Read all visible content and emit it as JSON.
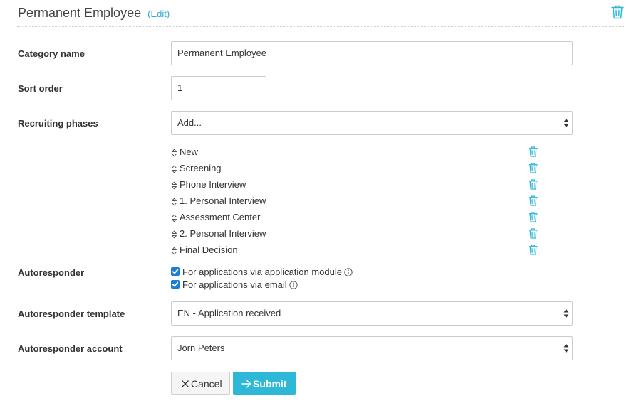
{
  "header": {
    "title": "Permanent Employee",
    "edit_label": "(Edit)"
  },
  "form": {
    "category_label": "Category name",
    "category_value": "Permanent Employee",
    "sort_label": "Sort order",
    "sort_value": "1",
    "phases_label": "Recruiting phases",
    "phases_select": "Add...",
    "phases": [
      "New",
      "Screening",
      "Phone Interview",
      "1. Personal Interview",
      "Assessment Center",
      "2. Personal Interview",
      "Final Decision"
    ],
    "autoresponder_label": "Autoresponder",
    "autoresponder_options": [
      {
        "label": "For applications via application module",
        "checked": true
      },
      {
        "label": "For applications via email",
        "checked": true
      }
    ],
    "template_label": "Autoresponder template",
    "template_value": "EN - Application received",
    "account_label": "Autoresponder account",
    "account_value": "Jörn Peters"
  },
  "buttons": {
    "cancel": "Cancel",
    "submit": "Submit"
  },
  "icons": {
    "delete": "trash-icon",
    "drag": "sort-grip-icon",
    "info": "info-icon",
    "cancel": "close-icon",
    "submit": "arrow-right-icon"
  },
  "colors": {
    "accent": "#2eb8d8",
    "link": "#2eaad4",
    "checkbox": "#1a7fd4"
  }
}
